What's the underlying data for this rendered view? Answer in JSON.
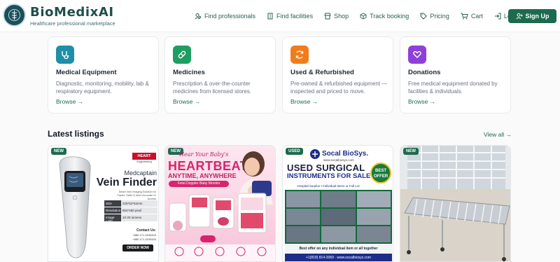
{
  "brand": {
    "name": "BioMedixAI",
    "tagline": "Healthcare professional marketplace"
  },
  "nav": {
    "items": [
      {
        "label": "Find professionals",
        "icon": "user-search-icon"
      },
      {
        "label": "Find facilities",
        "icon": "building-icon"
      },
      {
        "label": "Shop",
        "icon": "store-icon"
      },
      {
        "label": "Track booking",
        "icon": "box-icon"
      },
      {
        "label": "Pricing",
        "icon": "tag-icon"
      },
      {
        "label": "Cart",
        "icon": "cart-icon"
      },
      {
        "label": "Log in",
        "icon": "login-icon"
      }
    ],
    "signup": "Sign Up"
  },
  "categories": [
    {
      "title": "Medical Equipment",
      "desc": "Diagnostic, monitoring, mobility, lab & respiratory equipment.",
      "browse": "Browse",
      "icon": "stethoscope-icon",
      "color": "#1f8fa8"
    },
    {
      "title": "Medicines",
      "desc": "Prescription & over-the-counter medicines from licensed stores.",
      "browse": "Browse",
      "icon": "pill-icon",
      "color": "#1f9d62"
    },
    {
      "title": "Used & Refurbished",
      "desc": "Pre-owned & refurbished equipment — inspected and priced to move.",
      "browse": "Browse",
      "icon": "refresh-icon",
      "color": "#f07d1b"
    },
    {
      "title": "Donations",
      "desc": "Free medical equipment donated by facilities & individuals.",
      "browse": "Browse",
      "icon": "heart-hand-icon",
      "color": "#8f3fd9"
    }
  ],
  "latest": {
    "title": "Latest listings",
    "view_all": "View all"
  },
  "listings": [
    {
      "badge": "NEW",
      "brand_tag": "HEART",
      "brand_sub": "Engineering",
      "line1": "Medcaptain",
      "line2": "Vein Finder",
      "blurb": "Smart Vein Imaging Solution for Faster, Safer & More Accurate IV Access",
      "specs": [
        {
          "k": "Size",
          "v": "225*62*62mm"
        },
        {
          "k": "Resolution",
          "v": "854*480 pixel"
        },
        {
          "k": "Image Light",
          "v": "10-25 lumens"
        }
      ],
      "contact": "Contact Us:",
      "phone1": "+880 171-3159423",
      "phone2": "+880 171-3159434",
      "cta": "ORDER NOW"
    },
    {
      "badge": "NEW",
      "script": "Hear Your Baby's",
      "headline": "HEARTBEAT",
      "sub": "ANYTIME, ANYWHERE",
      "pill": "Fetal Doppler Baby Monitor"
    },
    {
      "badge": "USED",
      "company": "Socal BioSys.",
      "site": "www.socalbiosys.com",
      "h1": "USED SURGICAL",
      "h2": "INSTRUMENTS FOR SALE",
      "stamp1": "BEST",
      "stamp2": "OFFER",
      "bar": "Hospital Surplus • Individual Items or Full Lot",
      "offer": "Best offer on any individual item or all together",
      "footer": "+1(818) 814-3069 · www.socalbiosys.com"
    },
    {
      "badge": "NEW"
    }
  ],
  "colors": {
    "brand": "#1f4f4a",
    "accent": "#1d6b4f",
    "link": "#1f6a55"
  }
}
